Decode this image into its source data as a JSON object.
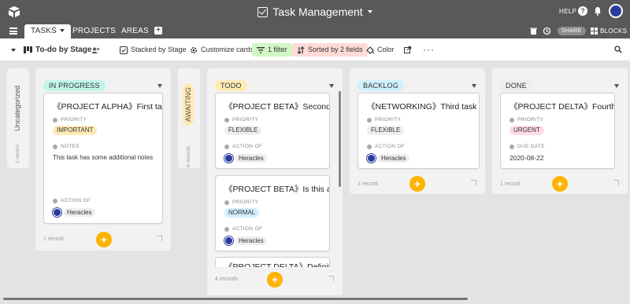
{
  "app": {
    "title": "Task Management",
    "help_label": "HELP",
    "share_label": "SHARE",
    "blocks_label": "BLOCKS"
  },
  "tabs": [
    {
      "label": "TASKS"
    },
    {
      "label": "PROJECTS"
    },
    {
      "label": "AREAS"
    }
  ],
  "toolbar": {
    "view_name": "To-do by Stage",
    "stacked_by": "Stacked by Stage",
    "customize": "Customize cards",
    "filter": "1 filter",
    "sorted": "Sorted by 2 fields",
    "color": "Color"
  },
  "colors": {
    "accent": "#fcb400",
    "topbar": "#595959",
    "filter_bg": "#d1f7c4",
    "sort_bg": "#ffdad6"
  },
  "columns": {
    "uncategorized": {
      "title": "Uncategorized",
      "count": "1 record"
    },
    "in_progress": {
      "title": "IN PROGRESS",
      "count": "1 record",
      "cards": [
        {
          "title": "《PROJECT ALPHA》First task",
          "priority_label": "PRIORITY",
          "priority": "IMPORTANT",
          "notes_label": "NOTES",
          "notes": "This task has some additional notes",
          "action_label": "ACTION OF",
          "person": "Heracles"
        }
      ]
    },
    "awaiting": {
      "title": "AWAITING",
      "count": "0 records"
    },
    "todo": {
      "title": "TODO",
      "count": "4 records",
      "cards": [
        {
          "title": "《PROJECT BETA》Second t...",
          "priority_label": "PRIORITY",
          "priority": "FLEXIBLE",
          "action_label": "ACTION OF",
          "person": "Heracles"
        },
        {
          "title": "《PROJECT BETA》Is this a t...",
          "priority_label": "PRIORITY",
          "priority": "NORMAL",
          "action_label": "ACTION OF",
          "person": "Heracles"
        },
        {
          "title": "《PROJECT DELTA》Definit..."
        }
      ]
    },
    "backlog": {
      "title": "BACKLOG",
      "count": "1 record",
      "cards": [
        {
          "title": "《NETWORKING》Third task",
          "priority_label": "PRIORITY",
          "priority": "FLEXIBLE",
          "action_label": "ACTION OF",
          "person": "Heracles"
        }
      ]
    },
    "done": {
      "title": "DONE",
      "count": "1 record",
      "cards": [
        {
          "title": "《PROJECT DELTA》Fourth task",
          "priority_label": "PRIORITY",
          "priority": "URGENT",
          "due_label": "DUE DATE",
          "due": "2020-08-22"
        }
      ]
    }
  }
}
